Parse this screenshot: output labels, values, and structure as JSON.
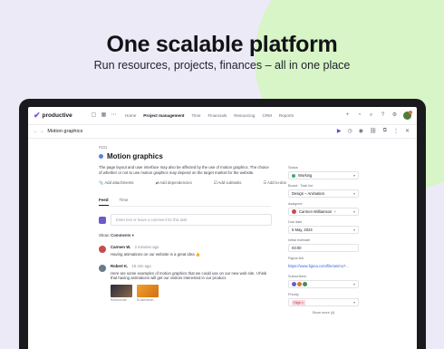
{
  "colors": {
    "background": "#eceaf6",
    "accent": "#7b4fe4",
    "blob": "#d7f5c6"
  },
  "hero": {
    "headline": "One scalable platform",
    "subheadline": "Run resources, projects, finances – all in one place"
  },
  "app": {
    "logo_text": "productive",
    "nav": [
      "Home",
      "Project management",
      "Time",
      "Financials",
      "Resourcing",
      "CRM",
      "Reports"
    ],
    "active_nav": "Project management"
  },
  "subbar": {
    "crumb": "Motion graphics"
  },
  "task": {
    "id": "#101",
    "title": "Motion graphics",
    "description": "The page layout and user interface may also be affected by the use of motion graphics. The choice of whether or not to use motion graphics may depend on the target market for the website.",
    "actions": [
      "Add attachments",
      "Add dependencies",
      "Add subtasks",
      "Add to-dos"
    ],
    "tabs": [
      "Feed",
      "Time"
    ],
    "active_tab": "Feed",
    "composer_placeholder": "Enter text or leave a comment for this task",
    "show_label": "Show:",
    "show_value": "Comments",
    "comments": [
      {
        "author": "Carmen W.",
        "time": "3 minutes ago",
        "body": "Having animations on our website is a great idea 👍"
      },
      {
        "author": "Robert K.",
        "time": "16 min ago",
        "body": "Here are some examples of motion graphics that we could use on our new web site. I think that having animations will get our visitors interested in our product.",
        "attachments": [
          "Robot.movie",
          "B-commerce..."
        ]
      }
    ]
  },
  "sidebar": {
    "status_label": "Status",
    "status_value": "Working",
    "board_label": "Board · Task list",
    "board_value": "Design – Animation",
    "assignee_label": "Assignee",
    "assignee_value": "Carmen Williamson",
    "due_label": "Due date",
    "due_value": "5 May, 2024",
    "initial_label": "Initial estimate",
    "initial_value": "03:00",
    "figma_label": "Figma link",
    "figma_value": "https://www.figma.com/file/animo7...",
    "subscribers_label": "Subscribers",
    "priority_label": "Priority",
    "priority_value": "High",
    "show_more": "Show more (4)"
  }
}
